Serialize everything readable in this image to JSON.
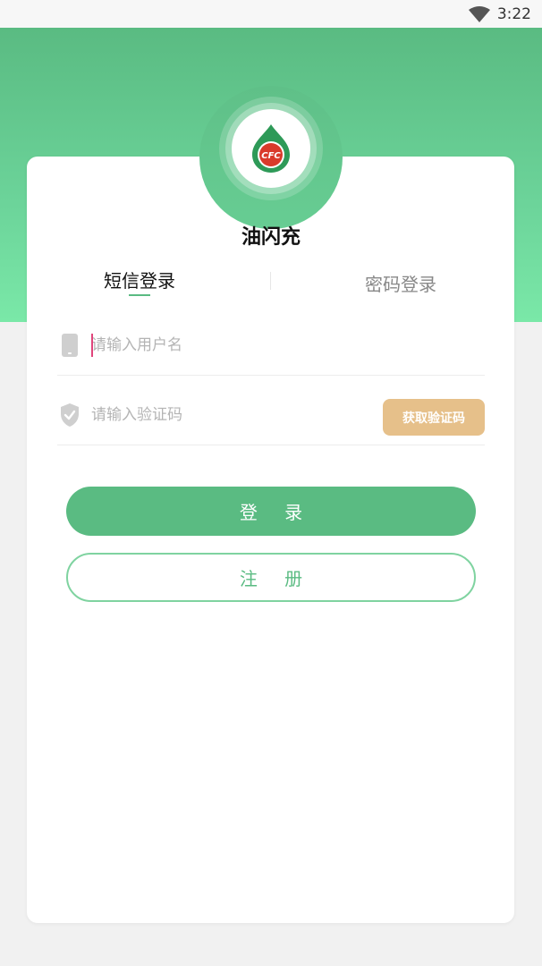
{
  "status_bar": {
    "time": "3:22",
    "wifi_icon": "wifi-icon"
  },
  "app": {
    "name": "油闪充",
    "logo_text": "CFC"
  },
  "tabs": [
    {
      "label": "短信登录",
      "active": true
    },
    {
      "label": "密码登录",
      "active": false
    }
  ],
  "form": {
    "username_placeholder": "请输入用户名",
    "username_value": "",
    "code_placeholder": "请输入验证码",
    "code_value": "",
    "get_code_label": "获取验证码"
  },
  "buttons": {
    "login_label": "登 录",
    "register_label": "注 册"
  },
  "colors": {
    "primary": "#5abb82",
    "accent": "#e6c08a",
    "cursor": "#e0457b"
  },
  "icons": {
    "username": "phone-icon",
    "code": "shield-check-icon"
  }
}
